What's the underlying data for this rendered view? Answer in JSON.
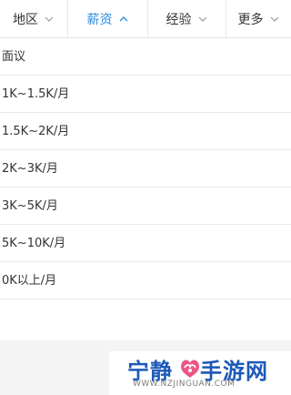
{
  "filter_bar": {
    "tabs": [
      {
        "label": "地区",
        "icon": "chevron-down-icon",
        "active": false
      },
      {
        "label": "薪资",
        "icon": "chevron-up-icon",
        "active": true
      },
      {
        "label": "经验",
        "icon": "chevron-down-icon",
        "active": false
      },
      {
        "label": "更多",
        "icon": "chevron-down-icon",
        "active": false
      }
    ]
  },
  "salary_options": [
    {
      "label": "面议"
    },
    {
      "label": "1K~1.5K/月"
    },
    {
      "label": "1.5K~2K/月"
    },
    {
      "label": "2K~3K/月"
    },
    {
      "label": "3K~5K/月"
    },
    {
      "label": "5K~10K/月"
    },
    {
      "label": "0K以上/月"
    }
  ],
  "watermark": {
    "brand": "宁静",
    "brand_suffix": "手游网",
    "url": "WWW.NZJINGUAN.COM"
  },
  "colors": {
    "accent": "#2a8de0",
    "text": "#333333",
    "icon_grey": "#999999",
    "divider": "#e9e9e9",
    "footer_bg": "#f4f4f4",
    "watermark_blue": "#1d59b8"
  }
}
